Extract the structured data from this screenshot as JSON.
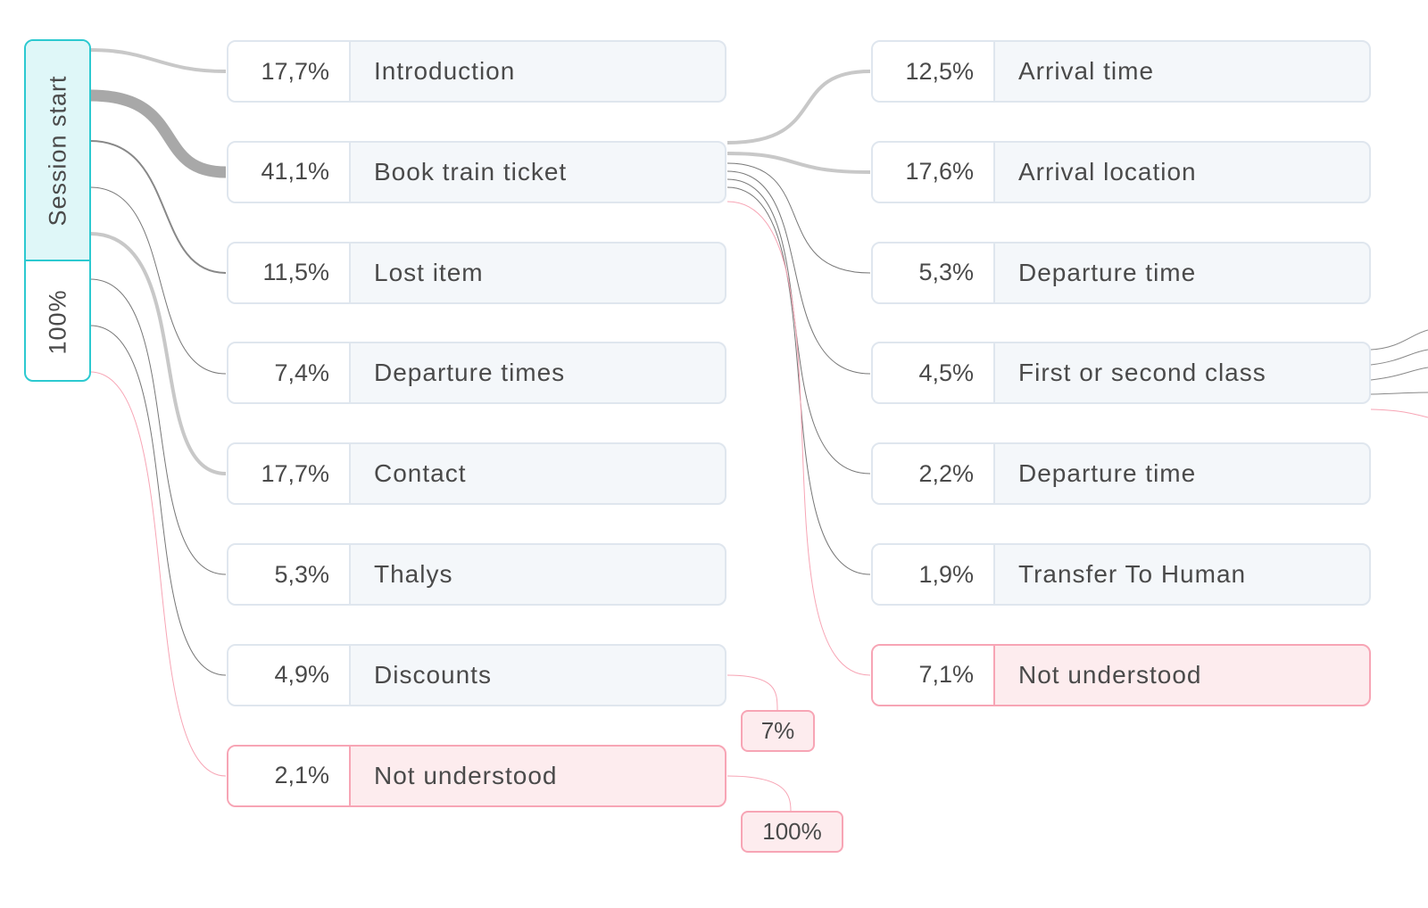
{
  "start": {
    "label": "Session start",
    "percent": "100%"
  },
  "level1": [
    {
      "percent": "17,7%",
      "label": "Introduction"
    },
    {
      "percent": "41,1%",
      "label": "Book train ticket"
    },
    {
      "percent": "11,5%",
      "label": "Lost item"
    },
    {
      "percent": "7,4%",
      "label": "Departure times"
    },
    {
      "percent": "17,7%",
      "label": "Contact"
    },
    {
      "percent": "5,3%",
      "label": "Thalys"
    },
    {
      "percent": "4,9%",
      "label": "Discounts"
    },
    {
      "percent": "2,1%",
      "label": "Not understood",
      "status": "error"
    }
  ],
  "level2": [
    {
      "percent": "12,5%",
      "label": "Arrival time"
    },
    {
      "percent": "17,6%",
      "label": "Arrival location"
    },
    {
      "percent": "5,3%",
      "label": "Departure time"
    },
    {
      "percent": "4,5%",
      "label": "First or second class"
    },
    {
      "percent": "2,2%",
      "label": "Departure time"
    },
    {
      "percent": "1,9%",
      "label": "Transfer To Human"
    },
    {
      "percent": "7,1%",
      "label": "Not understood",
      "status": "error"
    }
  ],
  "badges": {
    "discounts_exit": "7%",
    "not_understood_exit": "100%"
  },
  "colors": {
    "start": "#2cc9d0",
    "error": "#f7a5b5",
    "node_border": "#dfe6ee",
    "link": "#a8a8a8"
  }
}
